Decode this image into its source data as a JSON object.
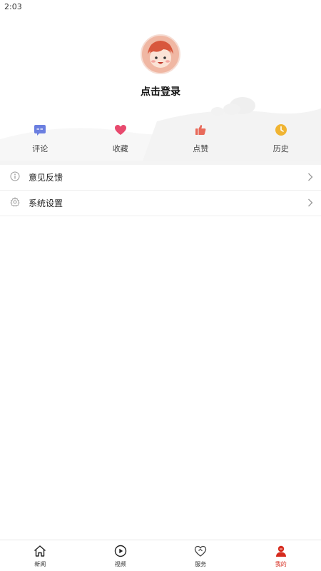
{
  "status_bar": {
    "time": "2:03"
  },
  "profile": {
    "login_text": "点击登录"
  },
  "quick_actions": [
    {
      "label": "评论",
      "icon": "comment-icon",
      "color": "#6b7fe0"
    },
    {
      "label": "收藏",
      "icon": "heart-icon",
      "color": "#e84a6e"
    },
    {
      "label": "点赞",
      "icon": "thumbs-up-icon",
      "color": "#e86a5a"
    },
    {
      "label": "历史",
      "icon": "clock-icon",
      "color": "#f0b432"
    }
  ],
  "menu": [
    {
      "label": "意见反馈",
      "icon": "info-icon"
    },
    {
      "label": "系统设置",
      "icon": "gear-icon"
    }
  ],
  "tabbar": {
    "active_color": "#d62b1e",
    "tabs": [
      {
        "label": "新闻",
        "icon": "home-icon"
      },
      {
        "label": "视频",
        "icon": "play-icon"
      },
      {
        "label": "服务",
        "icon": "service-heart-icon"
      },
      {
        "label": "我的",
        "icon": "user-icon",
        "active": true
      }
    ]
  }
}
